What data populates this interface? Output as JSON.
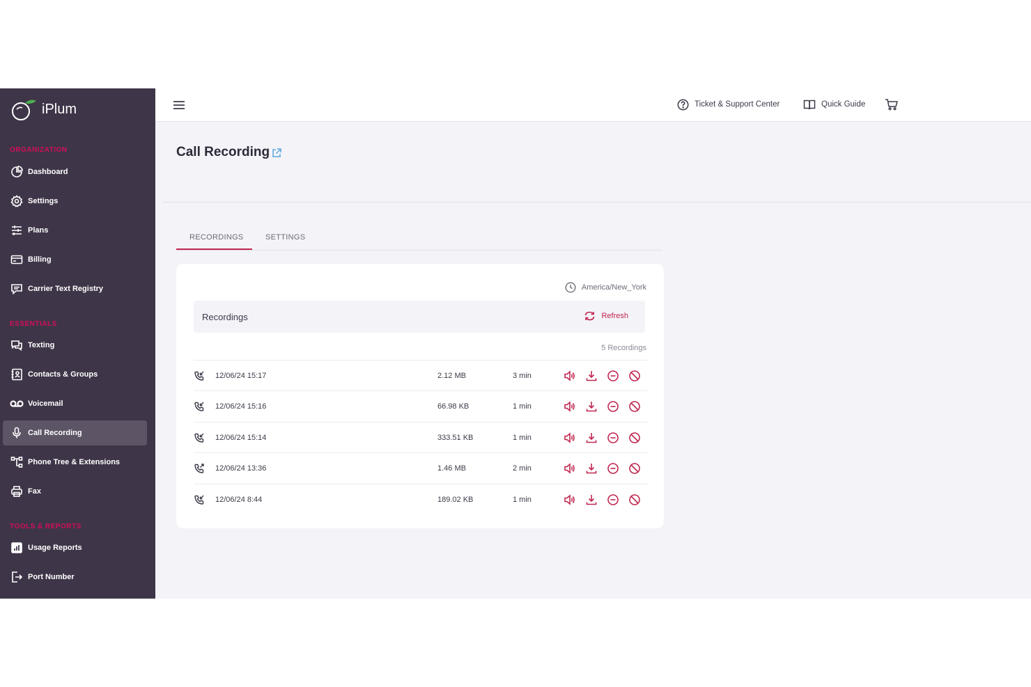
{
  "brand": {
    "name": "iPlum"
  },
  "sidebar": {
    "sections": [
      {
        "label": "ORGANIZATION"
      },
      {
        "label": "ESSENTIALS"
      },
      {
        "label": "TOOLS & REPORTS"
      }
    ],
    "items": [
      {
        "label": "Dashboard",
        "icon": "dashboard-icon"
      },
      {
        "label": "Settings",
        "icon": "gear-icon"
      },
      {
        "label": "Plans",
        "icon": "sliders-icon"
      },
      {
        "label": "Billing",
        "icon": "credit-card-icon"
      },
      {
        "label": "Carrier Text Registry",
        "icon": "message-icon"
      },
      {
        "label": "Texting",
        "icon": "chat-icon"
      },
      {
        "label": "Contacts & Groups",
        "icon": "contacts-icon"
      },
      {
        "label": "Voicemail",
        "icon": "voicemail-icon"
      },
      {
        "label": "Call Recording",
        "icon": "microphone-icon",
        "active": true
      },
      {
        "label": "Phone Tree & Extensions",
        "icon": "phone-tree-icon"
      },
      {
        "label": "Fax",
        "icon": "printer-icon"
      },
      {
        "label": "Usage Reports",
        "icon": "bar-chart-icon"
      },
      {
        "label": "Port Number",
        "icon": "port-icon"
      }
    ]
  },
  "topbar": {
    "support_label": "Ticket & Support Center",
    "guide_label": "Quick Guide"
  },
  "page": {
    "title": "Call Recording"
  },
  "tabs": [
    {
      "label": "RECORDINGS",
      "active": true
    },
    {
      "label": "SETTINGS",
      "active": false
    }
  ],
  "card": {
    "timezone": "America/New_York",
    "section_title": "Recordings",
    "refresh_label": "Refresh",
    "count_label": "5 Recordings",
    "rows": [
      {
        "direction": "incoming",
        "date": "12/06/24 15:17",
        "size": "2.12 MB",
        "duration": "3 min"
      },
      {
        "direction": "incoming",
        "date": "12/06/24 15:16",
        "size": "66.98 KB",
        "duration": "1 min"
      },
      {
        "direction": "incoming",
        "date": "12/06/24 15:14",
        "size": "333.51 KB",
        "duration": "1 min"
      },
      {
        "direction": "outgoing",
        "date": "12/06/24 13:36",
        "size": "1.46 MB",
        "duration": "2 min"
      },
      {
        "direction": "incoming",
        "date": "12/06/24 8:44",
        "size": "189.02 KB",
        "duration": "1 min"
      }
    ]
  },
  "colors": {
    "sidebar_bg": "#3f3548",
    "accent": "#c0264f",
    "section_label": "#d10f5a",
    "app_bg": "#f4f3f8"
  }
}
